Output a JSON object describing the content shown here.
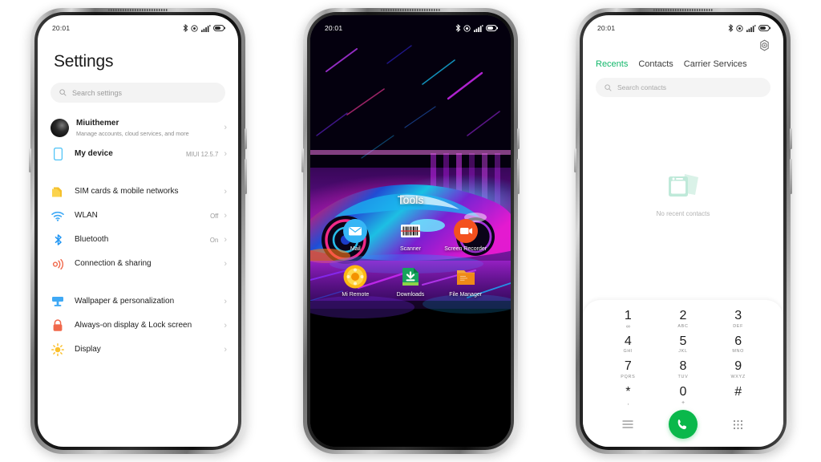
{
  "status_bar": {
    "time": "20:01",
    "icons": [
      "bluetooth-icon",
      "location-icon",
      "signal-icon",
      "battery-icon"
    ]
  },
  "phone1": {
    "app": "Settings",
    "title": "Settings",
    "search": {
      "placeholder": "Search settings",
      "icon": "search-icon"
    },
    "groups": [
      {
        "items": [
          {
            "label": "Miuithemer",
            "sub": "Manage accounts, cloud services, and more",
            "value": "",
            "icon": "account-avatar",
            "color": "#000000"
          },
          {
            "label": "My device",
            "sub": "",
            "value": "MIUI 12.5.7",
            "icon": "device-icon",
            "color": "#4FC3F7"
          }
        ]
      },
      {
        "items": [
          {
            "label": "SIM cards & mobile networks",
            "sub": "",
            "value": "",
            "icon": "sim-icon",
            "color": "#F5C02B"
          },
          {
            "label": "WLAN",
            "sub": "",
            "value": "Off",
            "icon": "wifi-icon",
            "color": "#3FA9F5"
          },
          {
            "label": "Bluetooth",
            "sub": "",
            "value": "On",
            "icon": "bluetooth-icon",
            "color": "#2196F3"
          },
          {
            "label": "Connection & sharing",
            "sub": "",
            "value": "",
            "icon": "connection-sharing-icon",
            "color": "#F0684B"
          }
        ]
      },
      {
        "items": [
          {
            "label": "Wallpaper & personalization",
            "sub": "",
            "value": "",
            "icon": "wallpaper-icon",
            "color": "#3FA9F5"
          },
          {
            "label": "Always-on display & Lock screen",
            "sub": "",
            "value": "",
            "icon": "lock-icon",
            "color": "#F0684B"
          },
          {
            "label": "Display",
            "sub": "",
            "value": "",
            "icon": "brightness-icon",
            "color": "#FBC02D"
          }
        ]
      }
    ],
    "chevron": "›"
  },
  "phone2": {
    "app": "Home screen",
    "folder_title": "Tools",
    "wallpaper": "neon-sports-car-wallpaper",
    "apps": [
      {
        "name": "Mail",
        "icon": "mail-icon",
        "color": "#35B5F5"
      },
      {
        "name": "Scanner",
        "icon": "barcode-scanner-icon",
        "color": "#FFFFFF"
      },
      {
        "name": "Screen Recorder",
        "icon": "screen-recorder-icon",
        "color": "#F4511E"
      },
      {
        "name": "Mi Remote",
        "icon": "mi-remote-icon",
        "color": "#FDB813"
      },
      {
        "name": "Downloads",
        "icon": "downloads-icon",
        "color": "#17A35C"
      },
      {
        "name": "File Manager",
        "icon": "file-manager-icon",
        "color": "#EF8A17"
      }
    ]
  },
  "phone3": {
    "app": "Phone",
    "settings_icon": "gear-icon",
    "tabs": [
      {
        "label": "Recents",
        "active": true
      },
      {
        "label": "Contacts",
        "active": false
      },
      {
        "label": "Carrier Services",
        "active": false
      }
    ],
    "search": {
      "placeholder": "Search contacts",
      "icon": "search-icon"
    },
    "empty": {
      "icon": "no-contacts-illustration",
      "text": "No recent contacts"
    },
    "accent_color": "#0AB84B",
    "keys": [
      {
        "digit": "1",
        "sub": "∞"
      },
      {
        "digit": "2",
        "sub": "ABC"
      },
      {
        "digit": "3",
        "sub": "DEF"
      },
      {
        "digit": "4",
        "sub": "GHI"
      },
      {
        "digit": "5",
        "sub": "JKL"
      },
      {
        "digit": "6",
        "sub": "MNO"
      },
      {
        "digit": "7",
        "sub": "PQRS"
      },
      {
        "digit": "8",
        "sub": "TUV"
      },
      {
        "digit": "9",
        "sub": "WXYZ"
      },
      {
        "digit": "*",
        "sub": ","
      },
      {
        "digit": "0",
        "sub": "+"
      },
      {
        "digit": "#",
        "sub": ""
      }
    ],
    "actions": {
      "menu": "menu-icon",
      "call": "call-icon",
      "keypad": "keypad-icon"
    }
  }
}
